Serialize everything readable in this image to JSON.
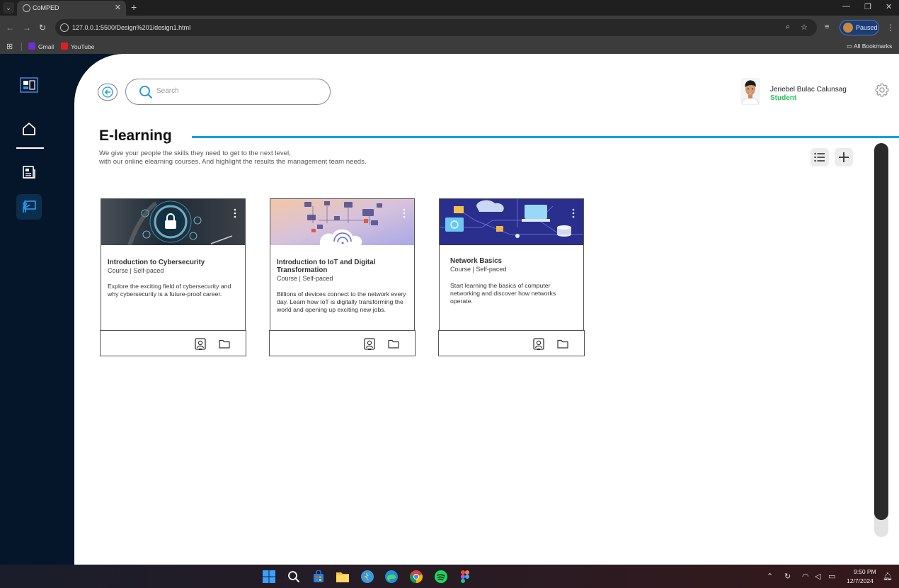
{
  "browser": {
    "tab_title": "CoMPED",
    "url": "127.0.0.1:5500/Design%201/design1.html",
    "profile_status": "Paused",
    "bookmarks": [
      {
        "label": "Gmail",
        "color": "#6b2fd6"
      },
      {
        "label": "YouTube",
        "color": "#e02020"
      }
    ],
    "all_bookmarks": "All Bookmarks"
  },
  "sidebar": {
    "items": [
      {
        "icon": "logo-icon"
      },
      {
        "icon": "home-icon"
      },
      {
        "icon": "news-icon"
      },
      {
        "icon": "teacher-board-icon",
        "active": true
      }
    ]
  },
  "header": {
    "search_placeholder": "Search",
    "user_name": "Jeriebel Bulac Calunsag",
    "user_role": "Student"
  },
  "page": {
    "title": "E-learning",
    "description_line1": "We give your people the skills they need to get to the next level,",
    "description_line2": "with our online elearning courses. And highlight the results the management team needs."
  },
  "courses": [
    {
      "title": "Introduction to Cybersecurity",
      "meta": "Course | Self-paced",
      "description": "Explore the exciting field of cybersecurity and why cybersecurity is a future-proof career."
    },
    {
      "title": "Introduction to IoT and Digital Transformation",
      "meta": "Course | Self-paced",
      "description": "Billions of devices connect to the network every day. Learn how IoT is digitally transforming the world and opening up exciting new jobs."
    },
    {
      "title": "Network Basics",
      "meta": "Course | Self-paced",
      "description": "Start learning the basics of computer networking and discover how networks operate."
    }
  ],
  "taskbar": {
    "time": "9:50 PM",
    "date": "12/7/2024"
  },
  "colors": {
    "accent": "#129fea",
    "sidebar_bg": "#05152a",
    "role_green": "#22c55e"
  }
}
